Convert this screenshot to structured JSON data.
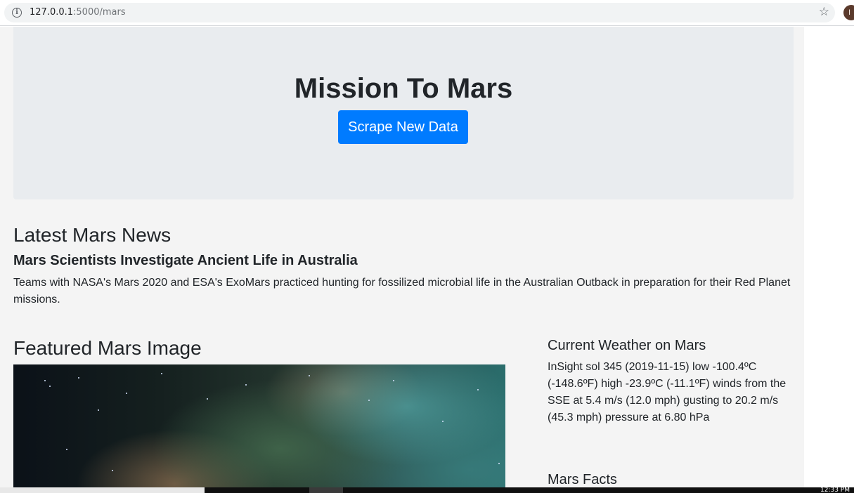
{
  "browser": {
    "url_host": "127.0.0.1",
    "url_path": ":5000/mars",
    "avatar_initial": "I"
  },
  "jumbotron": {
    "title": "Mission To Mars",
    "button_label": "Scrape New Data",
    "button_color": "#007bff"
  },
  "news": {
    "heading": "Latest Mars News",
    "title": "Mars Scientists Investigate Ancient Life in Australia",
    "body": "Teams with NASA's Mars 2020 and ESA's ExoMars practiced hunting for fossilized microbial life in the Australian Outback in preparation for their Red Planet missions."
  },
  "featured": {
    "heading": "Featured Mars Image"
  },
  "weather": {
    "heading": "Current Weather on Mars",
    "text": "InSight sol 345 (2019-11-15) low -100.4ºC (-148.6ºF) high -23.9ºC (-11.1ºF) winds from the SSE at 5.4 m/s (12.0 mph) gusting to 20.2 m/s (45.3 mph) pressure at 6.80 hPa"
  },
  "facts": {
    "heading": "Mars Facts"
  },
  "taskbar": {
    "clock": "12:33 PM"
  }
}
